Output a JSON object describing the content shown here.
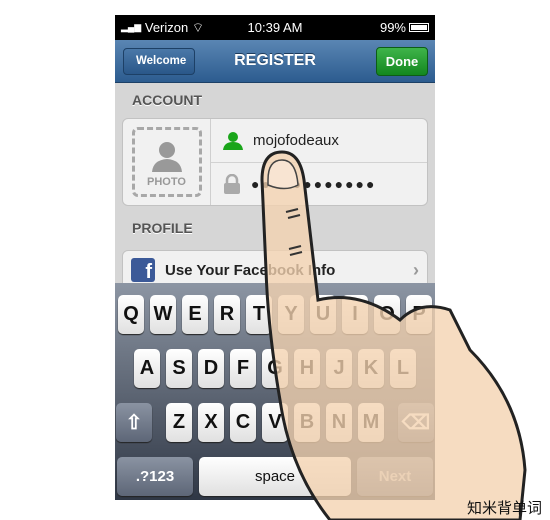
{
  "status": {
    "carrier": "Verizon",
    "time": "10:39 AM",
    "battery": "99%"
  },
  "nav": {
    "back": "Welcome",
    "title": "REGISTER",
    "done": "Done"
  },
  "account": {
    "heading": "ACCOUNT",
    "photo_label": "PHOTO",
    "username": "mojofodeaux",
    "password": "●●●●●●●●●●●●"
  },
  "profile": {
    "heading": "PROFILE",
    "facebook": "Use Your Facebook Info"
  },
  "keyboard": {
    "row1": [
      "Q",
      "W",
      "E",
      "R",
      "T",
      "Y",
      "U",
      "I",
      "O",
      "P"
    ],
    "row2": [
      "A",
      "S",
      "D",
      "F",
      "G",
      "H",
      "J",
      "K",
      "L"
    ],
    "row3": [
      "Z",
      "X",
      "C",
      "V",
      "B",
      "N",
      "M"
    ],
    "numbers": ".?123",
    "space": "space",
    "next": "Next"
  },
  "watermark": "知米背单词",
  "colors": {
    "nav": "#3a6a9c",
    "done": "#22a030",
    "user_icon": "#1aa51a"
  }
}
